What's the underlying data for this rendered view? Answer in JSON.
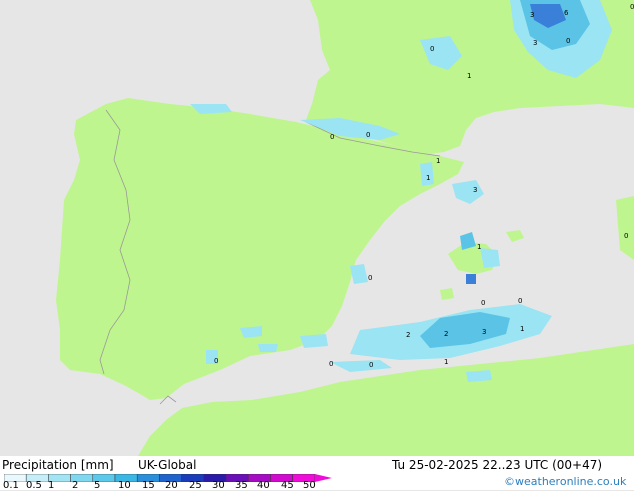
{
  "map": {
    "colors": {
      "sea": "#e6e6e6",
      "land": "#bff58e",
      "border": "#999999",
      "precip_light": "#9be4f3",
      "precip_mid": "#5bc4e6",
      "precip_heavy": "#3a7fd8"
    },
    "labels": [
      "3",
      "6",
      "0",
      "3",
      "0",
      "0",
      "1",
      "0",
      "0",
      "1",
      "1",
      "3",
      "1",
      "0",
      "0",
      "0",
      "0",
      "2",
      "2",
      "3",
      "1",
      "0",
      "0",
      "1",
      "0"
    ]
  },
  "footer": {
    "title": "Precipitation [mm]",
    "model": "UK-Global",
    "datetime": "Tu 25-02-2025 22..23 UTC (00+47)",
    "credit": "©weatheronline.co.uk"
  },
  "legend": {
    "ticks": [
      "0.1",
      "0.5",
      "1",
      "2",
      "5",
      "10",
      "15",
      "20",
      "25",
      "30",
      "35",
      "40",
      "45",
      "50"
    ],
    "colors": [
      "#e8f8fc",
      "#c5eef8",
      "#a2e4f4",
      "#7fd8f0",
      "#5cc9eb",
      "#3ab7e4",
      "#2b8edb",
      "#2163cc",
      "#1a3cbb",
      "#2a1ca8",
      "#6a10b8",
      "#a50cc4",
      "#d20ad0",
      "#ef0cd8"
    ]
  }
}
